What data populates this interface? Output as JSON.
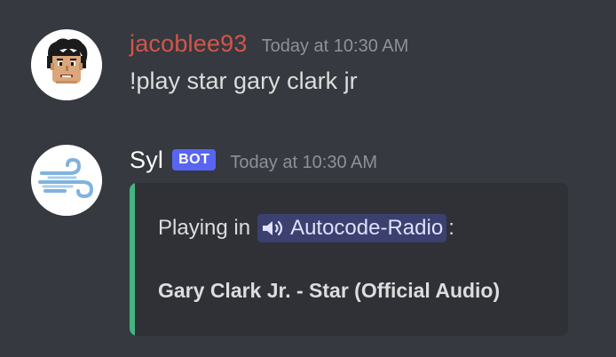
{
  "messages": [
    {
      "username": "jacoblee93",
      "timestamp": "Today at 10:30 AM",
      "content": "!play star gary clark jr",
      "avatar_icon": "pixel-face-avatar",
      "username_color": "#d2554a"
    },
    {
      "username": "Syl",
      "bot_tag": "BOT",
      "timestamp": "Today at 10:30 AM",
      "avatar_icon": "wind-avatar",
      "embed": {
        "prefix": "Playing in",
        "channel_icon": "speaker-icon",
        "channel_name": "Autocode-Radio",
        "suffix": ":",
        "title": "Gary Clark Jr. - Star (Official Audio)",
        "accent_color": "#43b581"
      }
    }
  ],
  "colors": {
    "background": "#36393f",
    "embed_background": "#2f3136",
    "bot_tag": "#5865f2",
    "timestamp": "#8e9297"
  }
}
